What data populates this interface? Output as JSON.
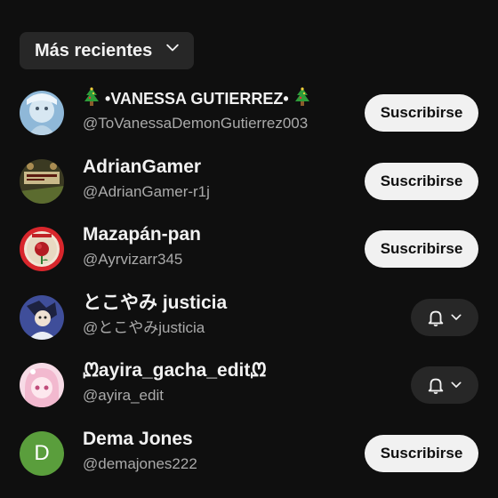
{
  "sort": {
    "label": "Más recientes",
    "icon": "chevron-down-icon"
  },
  "channels": [
    {
      "name": "•VANESSA GUTIERREZ•",
      "handle": "@ToVanessaDemonGutierrez003",
      "action": "Suscribirse",
      "decoration": "christmas-tree-icon"
    },
    {
      "name": "AdrianGamer",
      "handle": "@AdrianGamer-r1j",
      "action": "Suscribirse"
    },
    {
      "name": "Mazapán-pan",
      "handle": "@Ayrvizarr345",
      "action": "Suscribirse"
    },
    {
      "name": "とこやみ justicia",
      "handle": "@とこやみjusticia",
      "action_icon": "bell-icon"
    },
    {
      "name": "ᘻayira_gacha_editᘻ",
      "handle": "@ayira_edit",
      "action_icon": "bell-icon"
    },
    {
      "name": "Dema Jones",
      "handle": "@demajones222",
      "action": "Suscribirse",
      "avatar_letter": "D"
    }
  ],
  "colors": {
    "background": "#0f0f0f",
    "chip": "#272727",
    "subscribe_bg": "#f1f1f1",
    "avatar_green": "#5a9e3c"
  }
}
